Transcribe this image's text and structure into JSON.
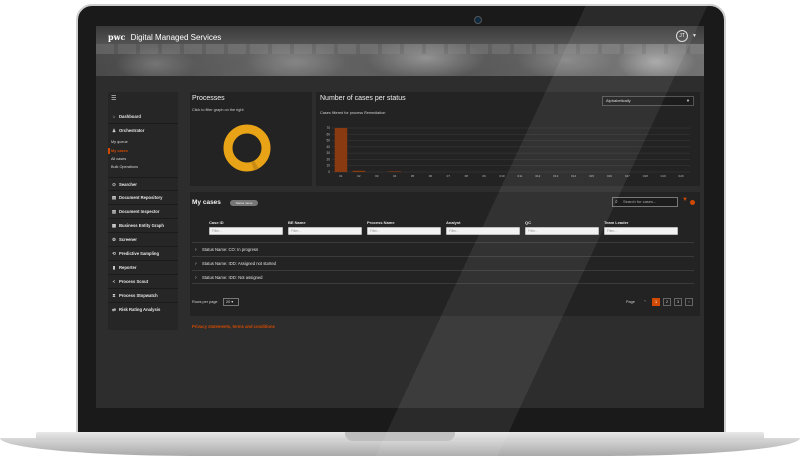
{
  "app": {
    "logo": "pwc",
    "title": "Digital Managed Services"
  },
  "user": {
    "initials": "JT"
  },
  "sidebar": {
    "items": [
      {
        "label": "Dashboard",
        "icon": "home-icon"
      },
      {
        "label": "Orchestrator",
        "icon": "person-icon"
      },
      {
        "label": "Searcher",
        "icon": "search-icon"
      },
      {
        "label": "Document Repository",
        "icon": "document-icon"
      },
      {
        "label": "Document Inspector",
        "icon": "document-search-icon"
      },
      {
        "label": "Business Entity Graph",
        "icon": "graph-icon"
      },
      {
        "label": "Screener",
        "icon": "gear-icon"
      },
      {
        "label": "Predictive Sampling",
        "icon": "sampling-icon"
      },
      {
        "label": "Reporter",
        "icon": "report-icon"
      },
      {
        "label": "Process Scout",
        "icon": "share-icon"
      },
      {
        "label": "Process Stopwatch",
        "icon": "stopwatch-icon"
      },
      {
        "label": "Risk Rating Analysis",
        "icon": "risk-icon"
      }
    ],
    "orchestrator_sub": [
      {
        "label": "My queue"
      },
      {
        "label": "My cases"
      },
      {
        "label": "All cases"
      },
      {
        "label": "Bulk Operations"
      }
    ]
  },
  "processes": {
    "title": "Processes",
    "subtitle": "Click to filter graph on the right",
    "colors": {
      "primary": "#e8a317",
      "secondary": "#b8800f"
    }
  },
  "status_chart": {
    "title": "Number of cases per status",
    "subtitle": "Cases filtered for process Remediation",
    "sort_select": "Alphabetically"
  },
  "chart_data": {
    "type": "bar",
    "categories": [
      "01",
      "02",
      "03",
      "04",
      "05",
      "06",
      "07",
      "08",
      "09",
      "010",
      "011",
      "012",
      "013",
      "014",
      "015",
      "016",
      "017",
      "018",
      "019",
      "020"
    ],
    "values": [
      70,
      2,
      0,
      1,
      0,
      0,
      0,
      0,
      0,
      0,
      0,
      0,
      0,
      0,
      0,
      0,
      0,
      0,
      0,
      0
    ],
    "ylim": [
      0,
      70
    ],
    "yticks": [
      "70",
      "60",
      "50",
      "40",
      "30",
      "20",
      "10",
      "0"
    ],
    "grid": true,
    "bar_color": "#8a3a10"
  },
  "my_cases": {
    "title": "My cases",
    "badge": "Status name",
    "search_placeholder": "Search for cases...",
    "columns": [
      {
        "label": "Case ID",
        "placeholder": "Filter..."
      },
      {
        "label": "BE Name",
        "placeholder": "Filter..."
      },
      {
        "label": "Process Name",
        "placeholder": "Filter..."
      },
      {
        "label": "Analyst",
        "placeholder": "Filter..."
      },
      {
        "label": "QC",
        "placeholder": "Filter..."
      },
      {
        "label": "Team Leader",
        "placeholder": "Filter..."
      }
    ],
    "groups": [
      {
        "label": "Status Name: CO: In progress"
      },
      {
        "label": "Status Name: IDD: Assigned not started"
      },
      {
        "label": "Status Name: IDD: Not assigned"
      }
    ],
    "rows_per_page_label": "Rows per page",
    "rows_per_page_value": "20",
    "page_label": "Page",
    "pages": [
      "1",
      "2",
      "3"
    ],
    "prev": "‹",
    "next": "›"
  },
  "footer": {
    "link": "Privacy statements, terms and conditions"
  }
}
